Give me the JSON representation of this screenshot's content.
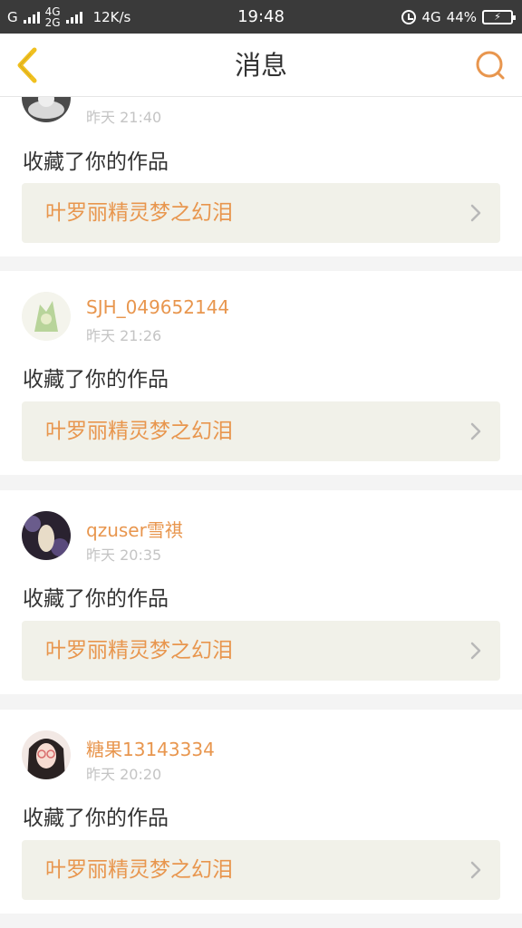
{
  "status_bar": {
    "carrier_g": "G",
    "net_top": "4G",
    "net_bottom": "2G",
    "speed": "12K/s",
    "time": "19:48",
    "net_right": "4G",
    "battery": "44%"
  },
  "nav": {
    "title": "消息",
    "back_icon": "chevron-left-icon",
    "search_icon": "search-icon",
    "accent_color": "#e8964e",
    "back_color": "#f0c020"
  },
  "messages": [
    {
      "username": "",
      "time": "昨天 21:40",
      "action": "收藏了你的作品",
      "work_title": "叶罗丽精灵梦之幻泪"
    },
    {
      "username": "SJH_049652144",
      "time": "昨天 21:26",
      "action": "收藏了你的作品",
      "work_title": "叶罗丽精灵梦之幻泪"
    },
    {
      "username": "qzuser雪祺",
      "time": "昨天 20:35",
      "action": "收藏了你的作品",
      "work_title": "叶罗丽精灵梦之幻泪"
    },
    {
      "username": "糖果13143334",
      "time": "昨天 20:20",
      "action": "收藏了你的作品",
      "work_title": "叶罗丽精灵梦之幻泪"
    }
  ]
}
